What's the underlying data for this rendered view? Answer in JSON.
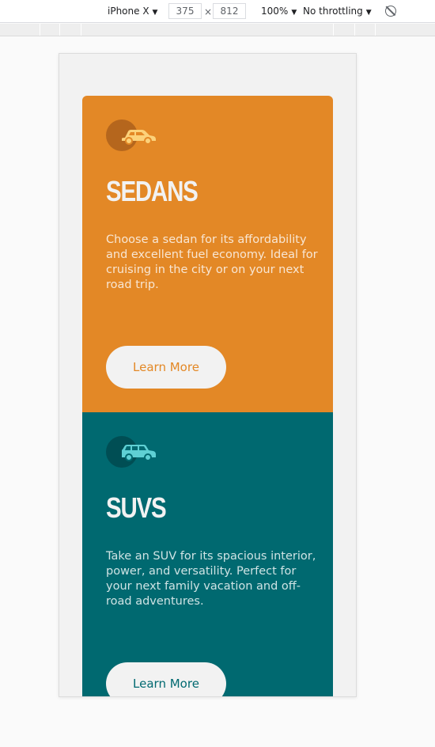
{
  "devtools": {
    "device": "iPhone X",
    "width": "375",
    "times": "×",
    "height": "812",
    "zoom": "100%",
    "throttling": "No throttling",
    "caret": "▼",
    "rotate_icon": "rotate-icon"
  },
  "cards": [
    {
      "icon": "sedan-car-icon",
      "title": "Sedans",
      "text": "Choose a sedan for its affordability and excellent fuel economy. Ideal for cruising in the city or on your next road trip.",
      "button": "Learn More",
      "color": "#e38826"
    },
    {
      "icon": "suv-car-icon",
      "title": "SUVs",
      "text": "Take an SUV for its spacious interior, power, and versatility. Perfect for your next family vacation and off-road adventures.",
      "button": "Learn More",
      "color": "#006970"
    }
  ]
}
